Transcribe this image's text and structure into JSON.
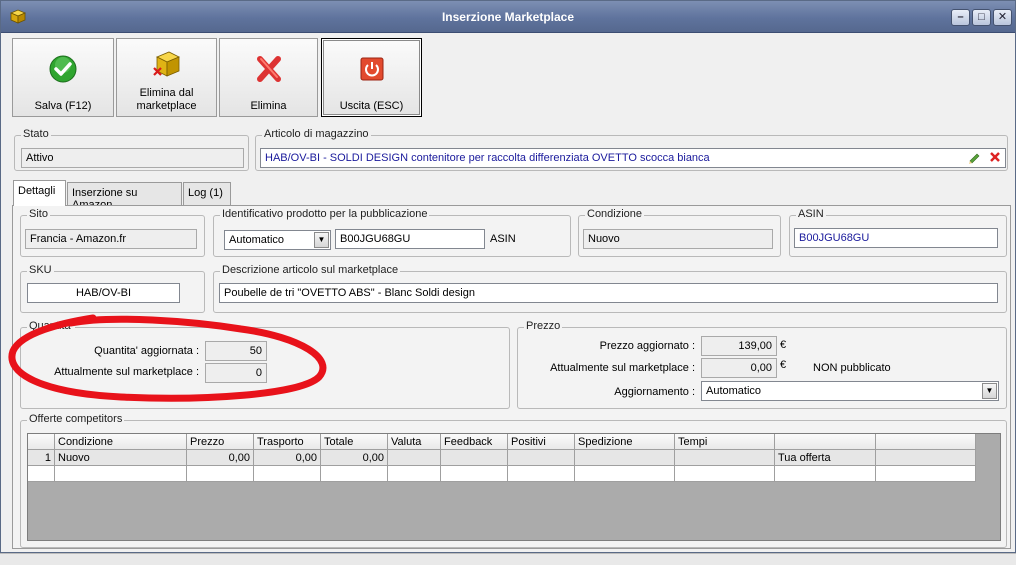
{
  "window": {
    "title": "Inserzione Marketplace"
  },
  "toolbar": {
    "save_label": "Salva (F12)",
    "remove_label_1": "Elimina dal",
    "remove_label_2": "marketplace",
    "delete_label": "Elimina",
    "exit_label": "Uscita (ESC)"
  },
  "stato": {
    "title": "Stato",
    "value": "Attivo"
  },
  "articolo": {
    "title": "Articolo di magazzino",
    "value": "HAB/OV-BI - SOLDI DESIGN contenitore per raccolta differenziata OVETTO scocca bianca"
  },
  "tabs": [
    {
      "label": "Dettagli"
    },
    {
      "label": "Inserzione su Amazon"
    },
    {
      "label": "Log (1)"
    }
  ],
  "sito": {
    "title": "Sito",
    "value": "Francia - Amazon.fr"
  },
  "identificativo": {
    "title": "Identificativo prodotto per la pubblicazione",
    "mode": "Automatico",
    "code": "B00JGU68GU",
    "suffix": "ASIN"
  },
  "condizione": {
    "title": "Condizione",
    "value": "Nuovo"
  },
  "asin": {
    "title": "ASIN",
    "value": "B00JGU68GU"
  },
  "sku": {
    "title": "SKU",
    "value": "HAB/OV-BI"
  },
  "descrizione": {
    "title": "Descrizione articolo sul marketplace",
    "value": "Poubelle de tri \"OVETTO ABS\" - Blanc Soldi design"
  },
  "quantita": {
    "title": "Quantita'",
    "updated_label": "Quantita' aggiornata :",
    "updated_value": "50",
    "market_label": "Attualmente sul marketplace :",
    "market_value": "0"
  },
  "prezzo": {
    "title": "Prezzo",
    "updated_label": "Prezzo aggiornato :",
    "updated_value": "139,00",
    "market_label": "Attualmente sul marketplace :",
    "market_value": "0,00",
    "currency": "€",
    "status": "NON pubblicato",
    "update_label": "Aggiornamento :",
    "update_value": "Automatico"
  },
  "offerte": {
    "title": "Offerte competitors",
    "headers": [
      "Condizione",
      "Prezzo",
      "Trasporto",
      "Totale",
      "Valuta",
      "Feedback",
      "Positivi",
      "Spedizione",
      "Tempi",
      "",
      ""
    ],
    "rows": [
      {
        "num": "1",
        "cells": [
          "Nuovo",
          "0,00",
          "0,00",
          "0,00",
          "",
          "",
          "",
          "",
          "",
          "Tua offerta",
          ""
        ]
      }
    ]
  },
  "colors": {
    "annotation": "#e8121a",
    "link_text": "#1a1a9c"
  }
}
